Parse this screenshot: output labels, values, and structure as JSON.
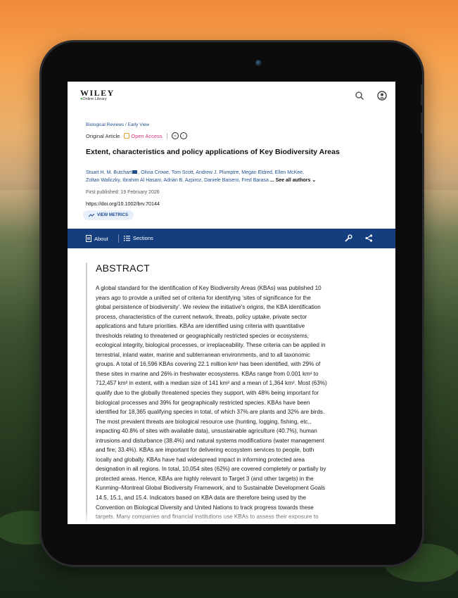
{
  "publisher": {
    "logo_main": "WILEY",
    "logo_sub": "Online Library"
  },
  "header": {
    "icons": [
      "search-icon",
      "user-icon"
    ]
  },
  "article": {
    "journal_breadcrumb": "Biological Reviews / Early View",
    "article_type": "Original Article",
    "open_access": "Open Access",
    "title": "Extent, characteristics and policy applications of Key Biodiversity Areas",
    "authors_line1": "Stuart H. M. Butchart",
    "authors_line1_rest": ", Olivia Crowe, Tom Scott, Andrew J. Plumptre, Megan Eldred, Ellen McKee,",
    "authors_line2": "Zoltan Waliczky, Ibrahim Al Hasani, Adrián B. Azpiroz, Daniele Baisero, Fred Barasa",
    "see_all": " ... See all authors",
    "first_published": "First published: 19 February 2026",
    "doi": "https://doi.org/10.1002/brv.70144",
    "metrics_button": "VIEW METRICS"
  },
  "toolbar": {
    "about": "About",
    "sections": "Sections",
    "icons": [
      "wrench-icon",
      "share-icon"
    ]
  },
  "abstract": {
    "heading": "ABSTRACT",
    "lines": [
      "A global standard for the identification of Key Biodiversity Areas (KBAs) was published 10",
      "years ago to provide a unified set of criteria for identifying ‘sites of significance for the",
      "global persistence of biodiversity’. We review the initiative's origins, the KBA identification",
      "process, characteristics of the current network, threats, policy uptake, private sector",
      "applications and future priorities. KBAs are identified using criteria with quantitative",
      "thresholds relating to threatened or geographically restricted species or ecosystems,",
      "ecological integrity, biological processes, or irreplaceability. These criteria can be applied in",
      "terrestrial, inland water, marine and subterranean environments, and to all taxonomic",
      "groups. A total of 16,596 KBAs covering 22.1 million km² has been identified, with 29% of",
      "these sites in marine and 26% in freshwater ecosystems. KBAs range from 0.001 km² to",
      "712,457 km² in extent, with a median size of 141 km² and a mean of 1,364 km². Most (63%)",
      "qualify due to the globally threatened species they support, with 48% being important for",
      "biological processes and 39% for geographically restricted species. KBAs have been",
      "identified for 18,365 qualifying species in total, of which 37% are plants and 32% are birds.",
      "The most prevalent threats are biological resource use (hunting, logging, fishing, etc.,",
      "impacting 40.8% of sites with available data), unsustainable agriculture (40.7%), human",
      "intrusions and disturbance (38.4%) and natural systems modifications (water management",
      "and fire; 33.4%). KBAs are important for delivering ecosystem services to people, both",
      "locally and globally. KBAs have had widespread impact in informing protected area",
      "designation in all regions. In total, 10,054 sites (62%) are covered completely or partially by",
      "protected areas. Hence, KBAs are highly relevant to Target 3 (and other targets) in the",
      "Kunming–Montreal Global Biodiversity Framework, and to Sustainable Development Goals",
      "14.5, 15.1, and 15.4. Indicators based on KBA data are therefore being used by the",
      "Convention on Biological Diversity and United Nations to track progress towards these",
      "targets. Many companies and financial institutions use KBAs to assess their exposure to"
    ]
  }
}
